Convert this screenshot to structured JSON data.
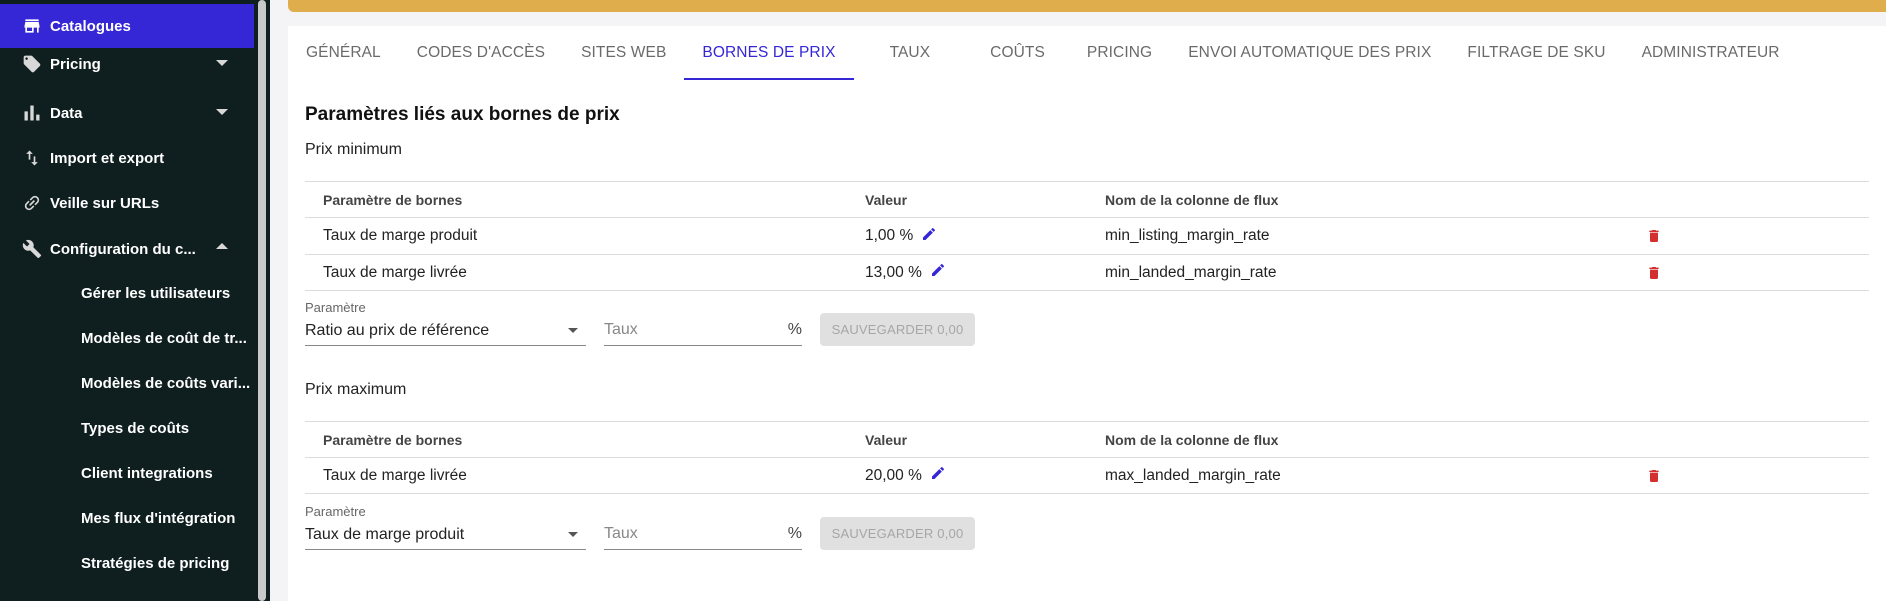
{
  "sidebar": {
    "items": [
      {
        "label": "Catalogues",
        "icon": "store-icon",
        "active": true
      },
      {
        "label": "Pricing",
        "icon": "tag-icon",
        "caret": "down"
      },
      {
        "label": "Data",
        "icon": "bar-chart-icon",
        "caret": "down"
      },
      {
        "label": "Import et export",
        "icon": "import-export-icon"
      },
      {
        "label": "Veille sur URLs",
        "icon": "link-icon"
      },
      {
        "label": "Configuration du c...",
        "icon": "wrench-icon",
        "caret": "up"
      }
    ],
    "subitems": [
      "Gérer les utilisateurs",
      "Modèles de coût de tr...",
      "Modèles de coûts vari...",
      "Types de coûts",
      "Client integrations",
      "Mes flux d'intégration",
      "Stratégies de pricing"
    ]
  },
  "tabs": [
    "GÉNÉRAL",
    "CODES D'ACCÈS",
    "SITES WEB",
    "BORNES DE PRIX",
    "TAUX",
    "COÛTS",
    "PRICING",
    "ENVOI AUTOMATIQUE DES PRIX",
    "FILTRAGE DE SKU",
    "ADMINISTRATEUR"
  ],
  "active_tab": "BORNES DE PRIX",
  "page_title": "Paramètres liés aux bornes de prix",
  "table_headers": {
    "param": "Paramètre de bornes",
    "value": "Valeur",
    "column": "Nom de la colonne de flux"
  },
  "min_section": {
    "title": "Prix minimum",
    "rows": [
      {
        "param": "Taux de marge produit",
        "value": "1,00 %",
        "column": "min_listing_margin_rate"
      },
      {
        "param": "Taux de marge livrée",
        "value": "13,00 %",
        "column": "min_landed_margin_rate"
      }
    ],
    "form": {
      "select_label": "Paramètre",
      "select_value": "Ratio au prix de référence",
      "rate_placeholder": "Taux",
      "rate_unit": "%",
      "save_label": "SAUVEGARDER 0,00"
    }
  },
  "max_section": {
    "title": "Prix maximum",
    "rows": [
      {
        "param": "Taux de marge livrée",
        "value": "20,00 %",
        "column": "max_landed_margin_rate"
      }
    ],
    "form": {
      "select_label": "Paramètre",
      "select_value": "Taux de marge produit",
      "rate_placeholder": "Taux",
      "rate_unit": "%",
      "save_label": "SAUVEGARDER 0,00"
    }
  },
  "colors": {
    "accent": "#3526d6",
    "sidebar_bg": "#0f1e1f",
    "banner": "#e0ad4c",
    "delete": "#d32f2f"
  }
}
